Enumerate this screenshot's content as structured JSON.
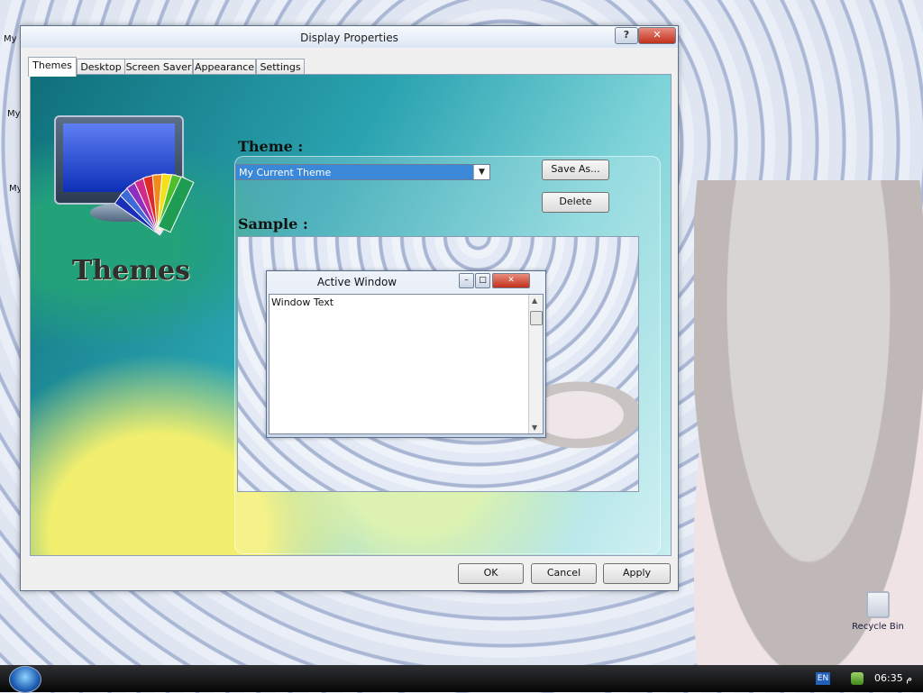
{
  "window": {
    "title": "Display Properties",
    "help_label": "?",
    "close_label": "✕"
  },
  "tabs": [
    "Themes",
    "Desktop",
    "Screen Saver",
    "Appearance",
    "Settings"
  ],
  "themes_panel": {
    "banner_label": "Themes",
    "theme_heading": "Theme :",
    "theme_select_value": "My Current Theme",
    "save_as_label": "Save As...",
    "delete_label": "Delete",
    "sample_heading": "Sample :"
  },
  "sample_window": {
    "title": "Active Window",
    "text": "Window Text"
  },
  "dialog_buttons": {
    "ok": "OK",
    "cancel": "Cancel",
    "apply": "Apply"
  },
  "desktop": {
    "icon_labels": [
      "My",
      "My",
      "My"
    ],
    "recycle_bin": "Recycle Bin"
  },
  "taskbar": {
    "language": "EN",
    "clock": "06:35 م"
  },
  "colors": {
    "selection": "#3b88d8",
    "close_button": "#c1301b"
  }
}
